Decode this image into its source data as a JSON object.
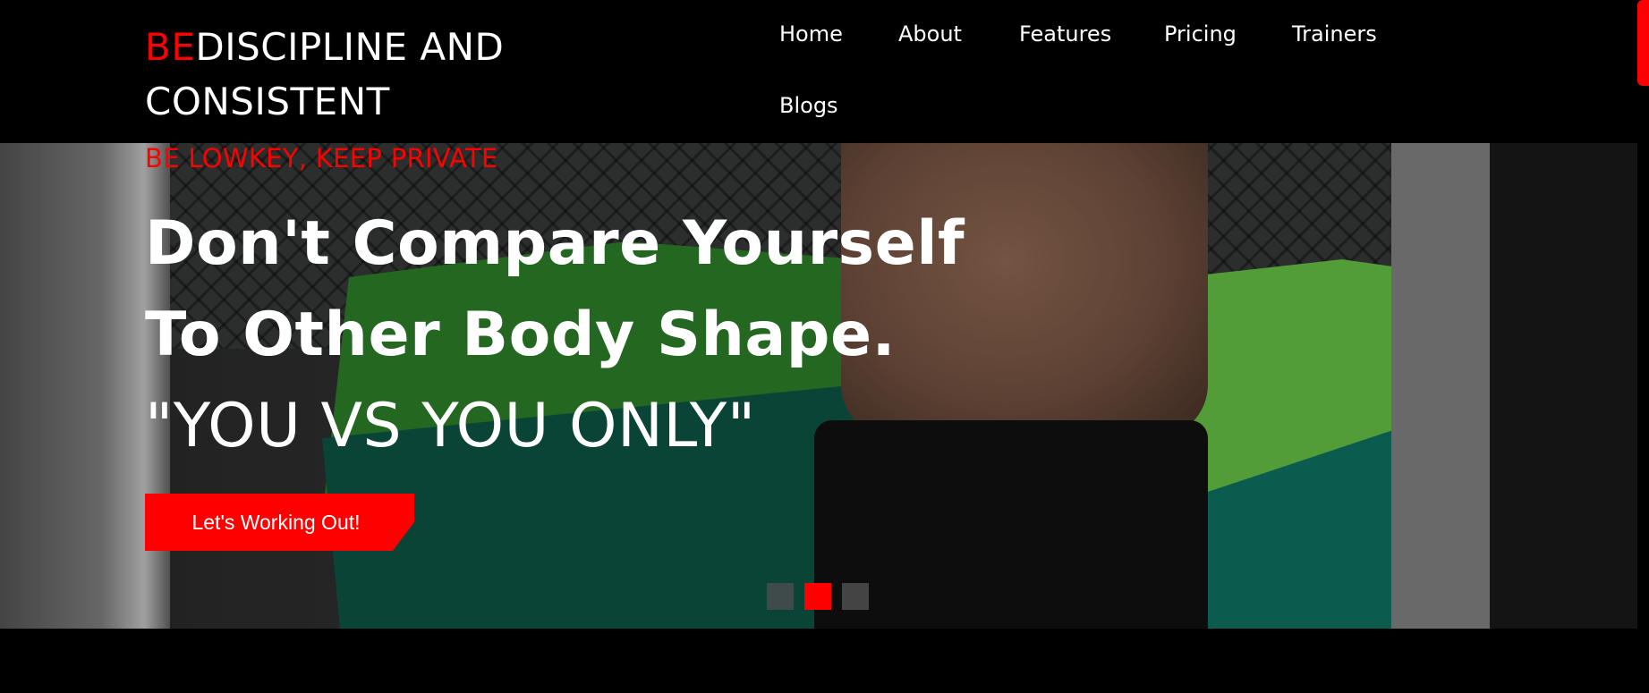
{
  "brand": {
    "prefix": "BE",
    "rest_line1": "DISCIPLINE AND",
    "line2": "CONSISTENT",
    "accent_color": "#ff0000"
  },
  "nav": {
    "items": [
      {
        "label": "Home"
      },
      {
        "label": "About"
      },
      {
        "label": "Features"
      },
      {
        "label": "Pricing"
      },
      {
        "label": "Trainers"
      },
      {
        "label": "Blogs"
      }
    ]
  },
  "hero": {
    "tagline": "BE LOWKEY, KEEP PRIVATE",
    "headline_line1": "Don't Compare Yourself",
    "headline_line2": "To Other Body Shape.",
    "headline_line3": "\"YOU VS YOU ONLY\"",
    "cta_label": "Let's Working Out!",
    "carousel": {
      "slide_count": 3,
      "active_slide": 2
    }
  }
}
